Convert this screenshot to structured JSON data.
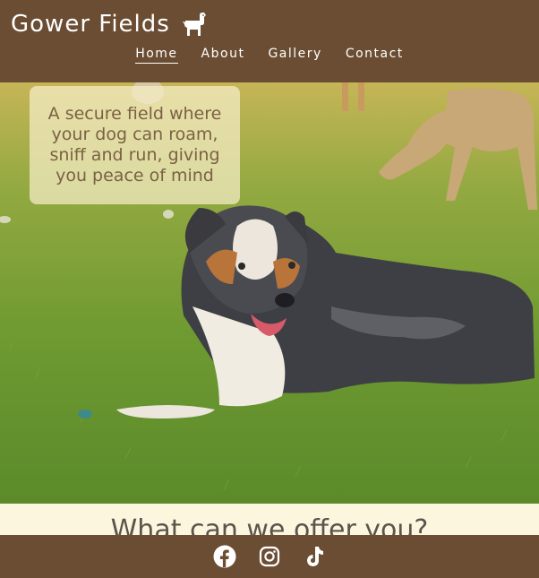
{
  "header": {
    "brand_name": "Gower Fields",
    "logo_icon": "dog-icon",
    "nav": [
      {
        "label": "Home",
        "active": true
      },
      {
        "label": "About",
        "active": false
      },
      {
        "label": "Gallery",
        "active": false
      },
      {
        "label": "Contact",
        "active": false
      }
    ]
  },
  "hero": {
    "tagline": "A secure field where your dog can roam, sniff and run, giving you peace of mind",
    "image": "dogs-in-field-photo"
  },
  "offer": {
    "heading": "What can we offer you?"
  },
  "footer": {
    "social": [
      "facebook-icon",
      "instagram-icon",
      "tiktok-icon"
    ]
  },
  "colors": {
    "brand_brown": "#6b4d33",
    "cream": "#fdf6df",
    "tagline_text": "#7b6144"
  }
}
